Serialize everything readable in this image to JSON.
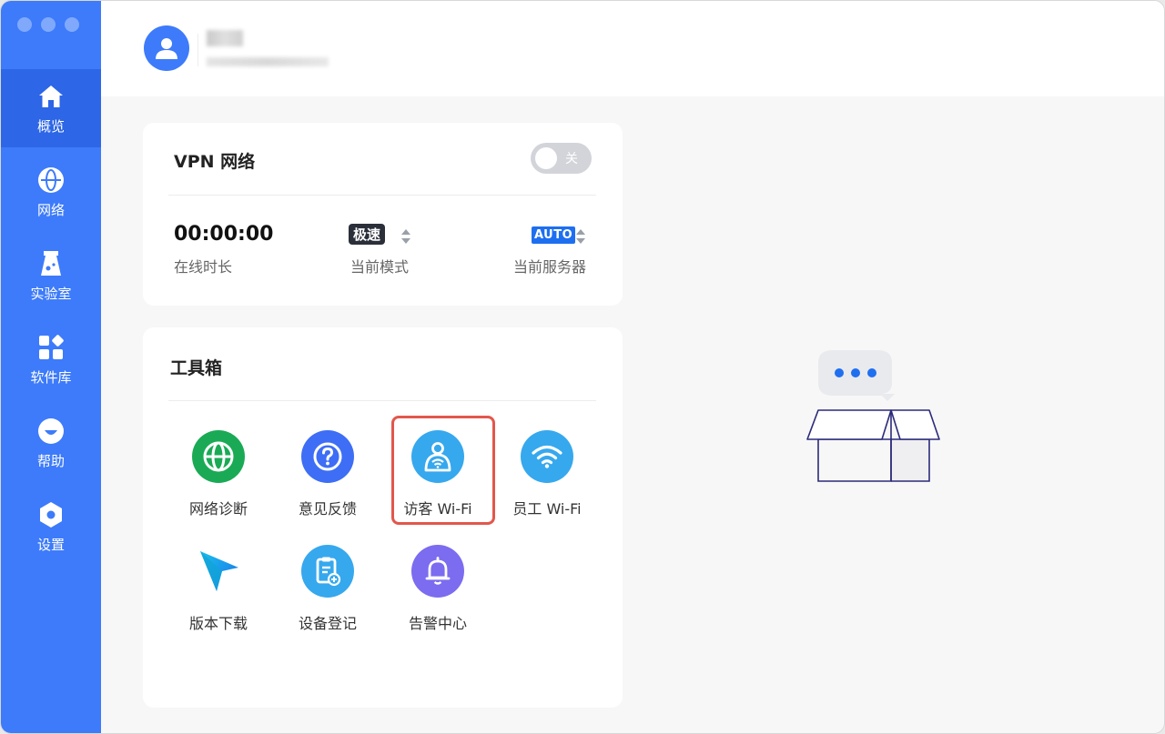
{
  "sidebar": {
    "items": [
      {
        "label": "概览",
        "icon": "home-icon",
        "active": true
      },
      {
        "label": "网络",
        "icon": "globe-icon"
      },
      {
        "label": "实验室",
        "icon": "flask-icon"
      },
      {
        "label": "软件库",
        "icon": "apps-icon"
      },
      {
        "label": "帮助",
        "icon": "help-face-icon"
      },
      {
        "label": "设置",
        "icon": "hex-settings-icon"
      }
    ]
  },
  "vpn": {
    "title": "VPN 网络",
    "toggle_label": "关",
    "online_time": "00:00:00",
    "online_time_label": "在线时长",
    "mode_badge": "极速",
    "mode_label": "当前模式",
    "server_badge": "AUTO",
    "server_label": "当前服务器"
  },
  "toolbox": {
    "title": "工具箱",
    "tools": [
      {
        "label": "网络诊断",
        "icon": "globe-icon",
        "color": "#1aaa55"
      },
      {
        "label": "意见反馈",
        "icon": "question-icon",
        "color": "#3d6ef5"
      },
      {
        "label": "访客 Wi-Fi",
        "icon": "guest-wifi-icon",
        "color": "#36a8ee"
      },
      {
        "label": "员工 Wi-Fi",
        "icon": "wifi-icon",
        "color": "#36a8ee"
      },
      {
        "label": "版本下载",
        "icon": "arrow-logo-icon",
        "color": "#1e7ff0"
      },
      {
        "label": "设备登记",
        "icon": "clipboard-add-icon",
        "color": "#36a8ee"
      },
      {
        "label": "告警中心",
        "icon": "bell-icon",
        "color": "#7b6cf0"
      }
    ]
  },
  "colors": {
    "sidebar": "#3d7bfa",
    "sidebar_active": "#2d66e6",
    "highlight": "#e2574c"
  }
}
